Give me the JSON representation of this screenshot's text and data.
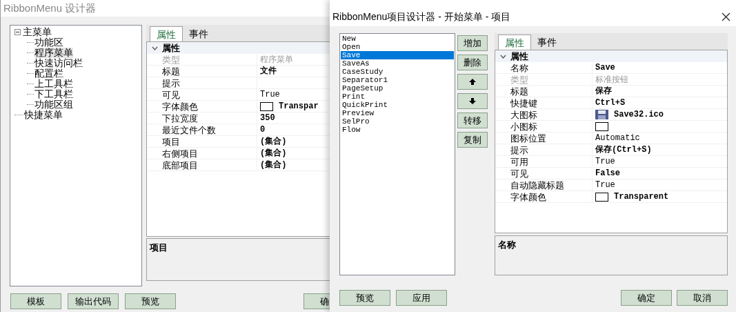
{
  "back_window": {
    "title": "RibbonMenu 设计器",
    "tree": [
      {
        "label": "主菜单",
        "expanded": true,
        "selected": false,
        "children": [
          {
            "label": "功能区",
            "selected": false
          },
          {
            "label": "程序菜单",
            "selected": true
          },
          {
            "label": "快速访问栏",
            "selected": false
          },
          {
            "label": "配置栏",
            "selected": false
          },
          {
            "label": "上工具栏",
            "selected": false
          },
          {
            "label": "下工具栏",
            "selected": false
          },
          {
            "label": "功能区组",
            "selected": false
          }
        ]
      },
      {
        "label": "快捷菜单",
        "selected": false
      }
    ],
    "tabs": [
      {
        "label": "属性",
        "selected": true
      },
      {
        "label": "事件",
        "selected": false
      }
    ],
    "category": "属性",
    "category_expanded": true,
    "properties": [
      {
        "label": "类型",
        "value": "程序菜单",
        "readonly": true,
        "bold": false
      },
      {
        "label": "标题",
        "value": "文件",
        "readonly": false,
        "bold": true
      },
      {
        "label": "提示",
        "readonly": false
      },
      {
        "label": "可见",
        "value": "True",
        "readonly": false,
        "bold": false
      },
      {
        "label": "字体颜色",
        "value": "Transpar",
        "readonly": false,
        "bold": true,
        "kind": "color"
      },
      {
        "label": "下拉宽度",
        "value": "350",
        "readonly": false,
        "bold": true
      },
      {
        "label": "最近文件个数",
        "value": "0",
        "readonly": false,
        "bold": true
      },
      {
        "label": "项目",
        "value": "(集合)",
        "readonly": false,
        "bold": true
      },
      {
        "label": "右侧项目",
        "value": "(集合)",
        "readonly": false,
        "bold": true
      },
      {
        "label": "底部项目",
        "value": "(集合)",
        "readonly": false,
        "bold": true
      }
    ],
    "description": "项目",
    "buttons": [
      "模板",
      "输出代码",
      "预览"
    ],
    "cut_button": "确"
  },
  "dialog": {
    "title": "RibbonMenu项目设计器 - 开始菜单 - 项目",
    "items": [
      {
        "label": "New",
        "selected": false
      },
      {
        "label": "Open",
        "selected": false
      },
      {
        "label": "Save",
        "selected": true
      },
      {
        "label": "SaveAs",
        "selected": false
      },
      {
        "label": "CaseStudy",
        "selected": false
      },
      {
        "label": "Separator1",
        "selected": false
      },
      {
        "label": "PageSetup",
        "selected": false
      },
      {
        "label": "Print",
        "selected": false
      },
      {
        "label": "QuickPrint",
        "selected": false
      },
      {
        "label": "Preview",
        "selected": false
      },
      {
        "label": "SelPro",
        "selected": false
      },
      {
        "label": "Flow",
        "selected": false
      }
    ],
    "side_buttons": [
      {
        "kind": "text",
        "label": "增加"
      },
      {
        "kind": "text",
        "label": "删除"
      },
      {
        "kind": "up"
      },
      {
        "kind": "down"
      },
      {
        "kind": "text",
        "label": "转移"
      },
      {
        "kind": "text",
        "label": "复制"
      }
    ],
    "tabs": [
      {
        "label": "属性",
        "selected": true
      },
      {
        "label": "事件",
        "selected": false
      }
    ],
    "category": "属性",
    "category_expanded": true,
    "properties": [
      {
        "label": "名称",
        "value": "Save",
        "readonly": false,
        "bold": true
      },
      {
        "label": "类型",
        "value": "标准按钮",
        "readonly": true,
        "bold": false
      },
      {
        "label": "标题",
        "value": "保存",
        "readonly": false,
        "bold": true
      },
      {
        "label": "快捷键",
        "value": "Ctrl+S",
        "readonly": false,
        "bold": true
      },
      {
        "label": "大图标",
        "value": "Save32.ico",
        "readonly": false,
        "bold": true,
        "kind": "image"
      },
      {
        "label": "小图标",
        "readonly": false,
        "kind": "color"
      },
      {
        "label": "图标位置",
        "value": "Automatic",
        "readonly": false,
        "bold": false
      },
      {
        "label": "提示",
        "value": "保存(Ctrl+S)",
        "readonly": false,
        "bold": true
      },
      {
        "label": "可用",
        "value": "True",
        "readonly": false,
        "bold": false
      },
      {
        "label": "可见",
        "value": "False",
        "readonly": false,
        "bold": true
      },
      {
        "label": "自动隐藏标题",
        "value": "True",
        "readonly": false,
        "bold": false
      },
      {
        "label": "字体颜色",
        "value": "Transparent",
        "readonly": false,
        "bold": true,
        "kind": "color"
      }
    ],
    "description": "名称",
    "left_buttons": [
      "预览",
      "应用"
    ],
    "right_buttons": [
      "确定",
      "取消"
    ]
  }
}
